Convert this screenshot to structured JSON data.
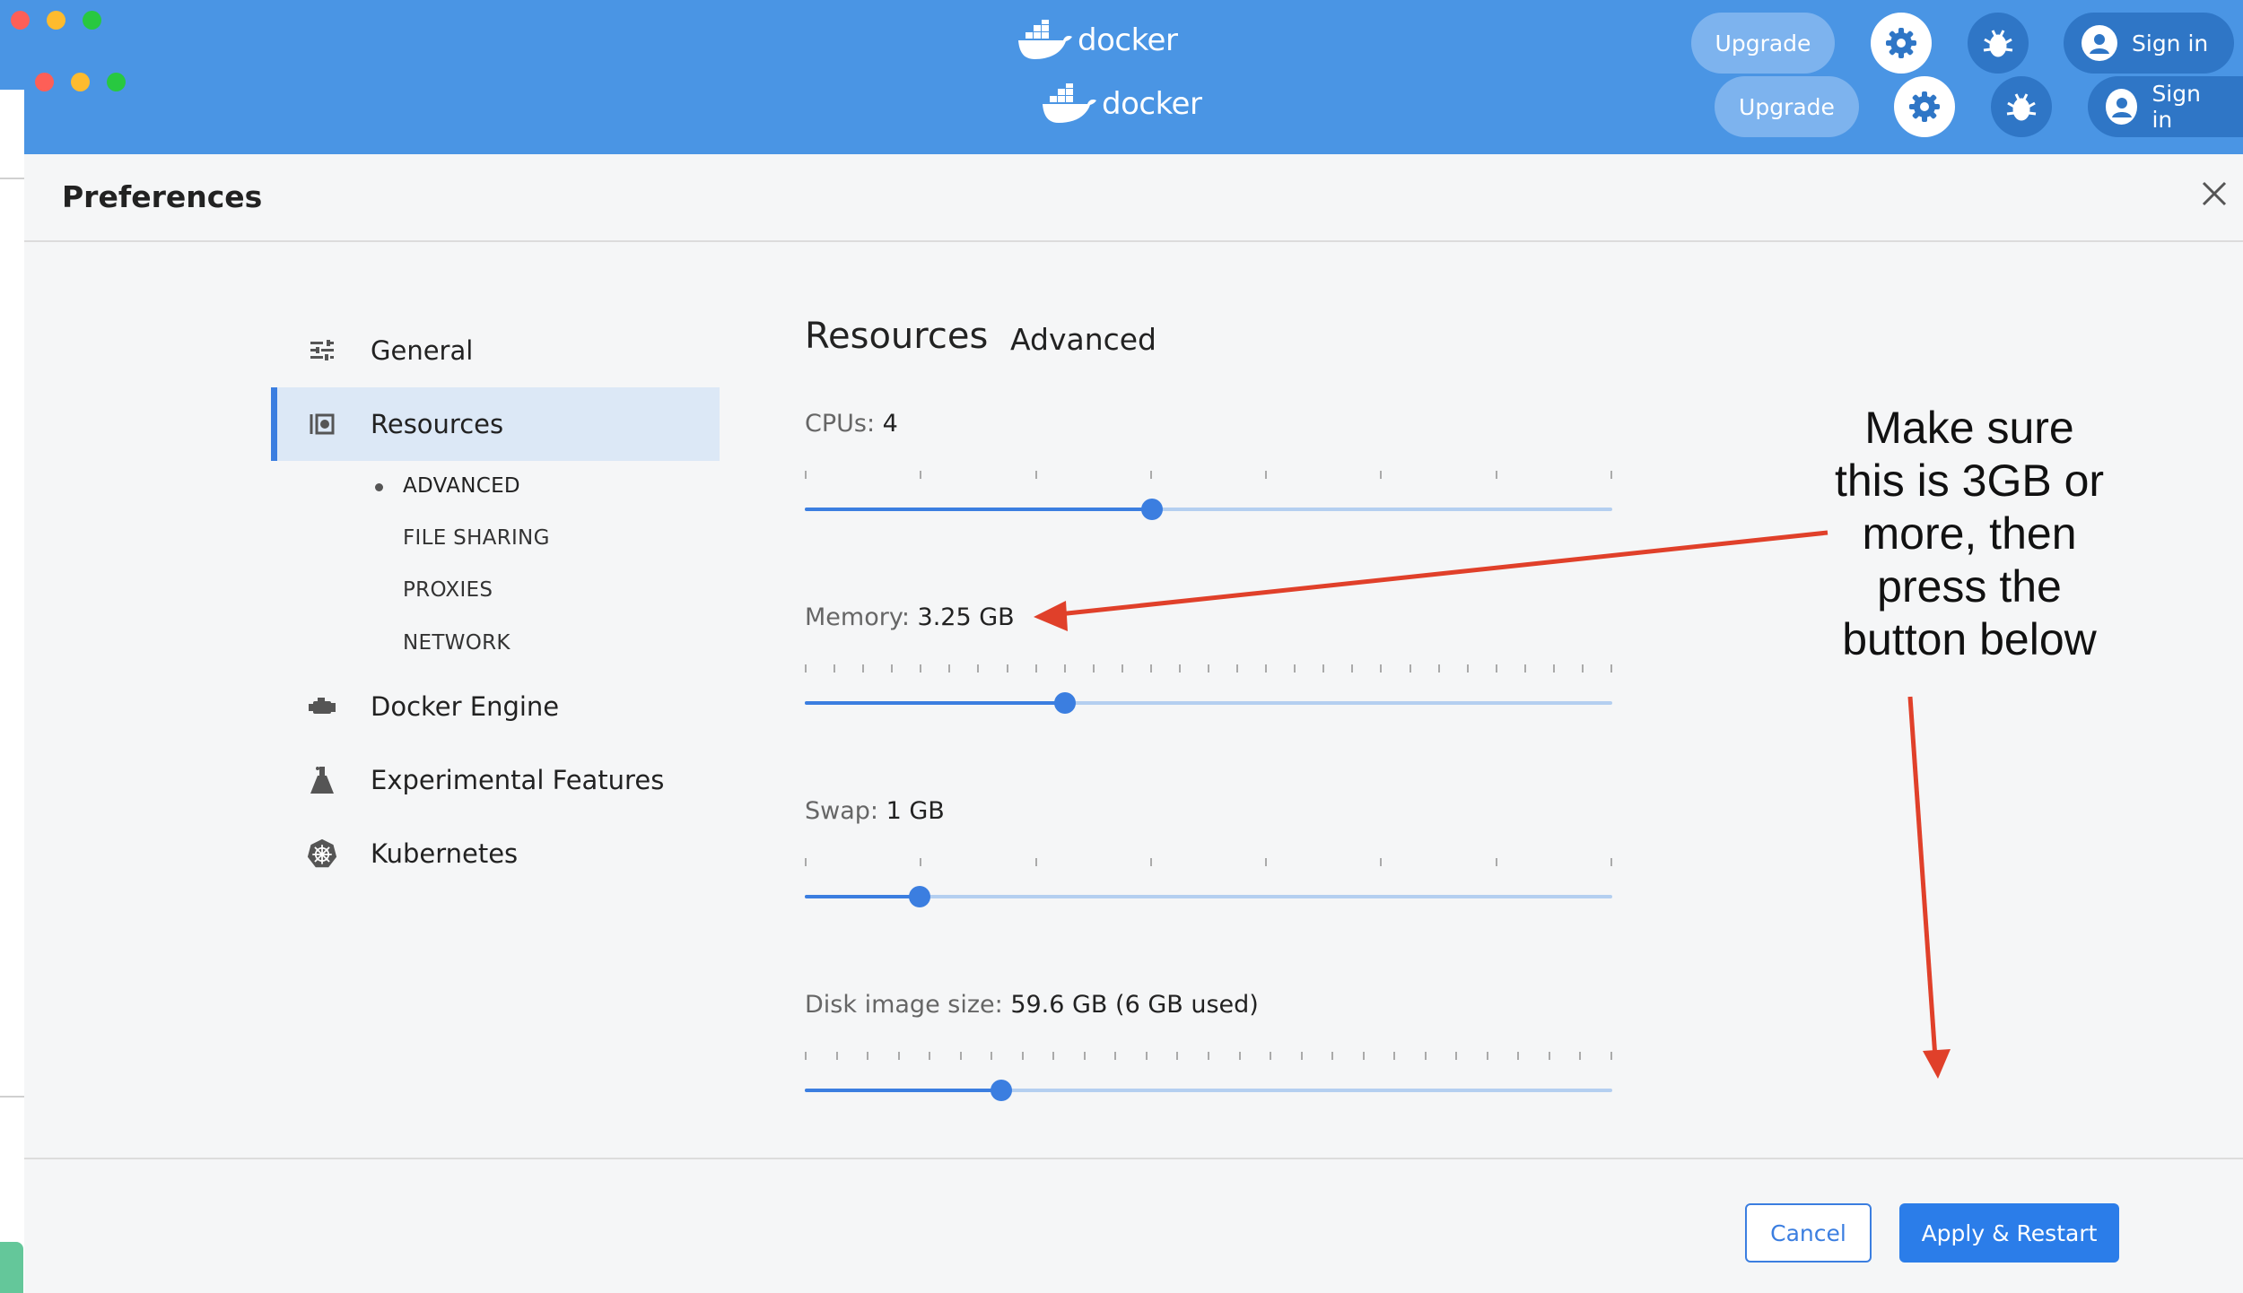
{
  "header": {
    "logo_text": "docker",
    "upgrade_label": "Upgrade",
    "signin_label": "Sign in"
  },
  "preferences": {
    "title": "Preferences"
  },
  "sidebar": {
    "items": [
      {
        "label": "General",
        "icon": "sliders-icon"
      },
      {
        "label": "Resources",
        "icon": "resources-icon",
        "active": true
      },
      {
        "label": "Docker Engine",
        "icon": "engine-icon"
      },
      {
        "label": "Experimental Features",
        "icon": "flask-icon"
      },
      {
        "label": "Kubernetes",
        "icon": "kubernetes-icon"
      }
    ],
    "subitems": [
      "ADVANCED",
      "FILE SHARING",
      "PROXIES",
      "NETWORK"
    ]
  },
  "content": {
    "heading": "Resources",
    "subheading": "Advanced",
    "sliders": [
      {
        "label": "CPUs:",
        "value": "4",
        "fraction": 0.43,
        "ticks": 8
      },
      {
        "label": "Memory:",
        "value": "3.25 GB",
        "fraction": 0.322,
        "ticks": 29
      },
      {
        "label": "Swap:",
        "value": "1 GB",
        "fraction": 0.142,
        "ticks": 8
      },
      {
        "label": "Disk image size:",
        "value": "59.6 GB (6 GB used)",
        "fraction": 0.243,
        "ticks": 27
      }
    ]
  },
  "annotation": {
    "lines": [
      "Make sure",
      "this is 3GB or",
      "more, then",
      "press the",
      "button below"
    ]
  },
  "footer": {
    "cancel_label": "Cancel",
    "apply_label": "Apply & Restart"
  },
  "colors": {
    "header": "#4a95e4",
    "accent": "#3b7ee0",
    "annotation_arrow": "#e0402a"
  }
}
